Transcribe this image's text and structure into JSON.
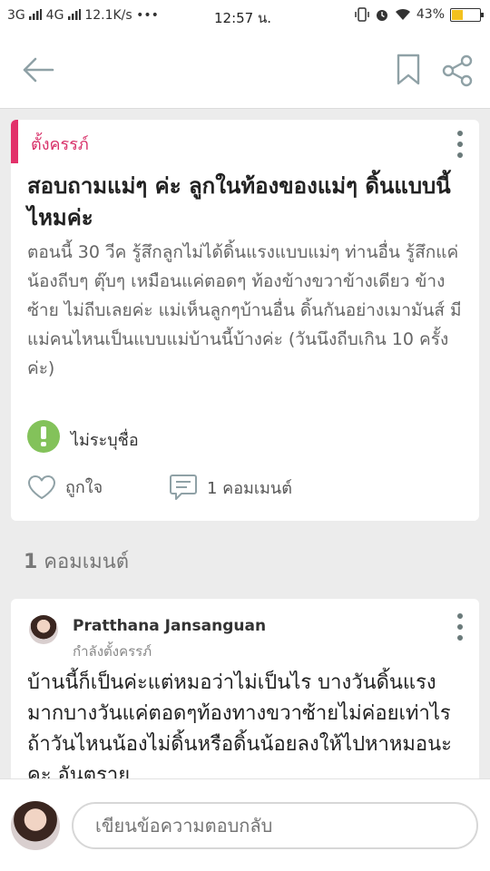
{
  "status_bar": {
    "left": "3G ",
    "left_2": " 4G ",
    "speed": " 12.1K/s •••",
    "time": "12:57 น.",
    "battery_text": "43%",
    "battery_level": 0.43,
    "battery_color": "#f3c11e"
  },
  "post": {
    "tag": "ตั้งครรภ์",
    "title": "สอบถามแม่ๆ ค่ะ ลูกในท้องของแม่ๆ ดิ้นแบบนี้ไหมค่ะ",
    "body": "ตอนนี้ 30 วีค รู้สึกลูกไม่ได้ดิ้นแรงแบบแม่ๆ ท่านอื่น รู้สึกแค่น้องถีบๆ ตุ๊บๆ เหมือนแค่ตอดๆ ท้องข้างขวาข้างเดียว ข้างซ้าย ไม่ถีบเลยค่ะ แม่เห็นลูกๆบ้านอื่น ดิ้นกันอย่างเมามันส์ มีแม่คนไหนเป็นแบบแม่บ้านนี้บ้างค่ะ (วันนึงถีบเกิน 10 ครั้งค่ะ)",
    "author": "ไม่ระบุชื่อ",
    "like_label": "ถูกใจ",
    "comment_label": "1 คอมเมนต์"
  },
  "comments_header": {
    "count": "1",
    "label": " คอมเมนต์"
  },
  "comments": [
    {
      "author": "Pratthana Jansanguan",
      "subtitle": "กำลังตั้งครรภ์",
      "text": "บ้านนี้ก็เป็นค่ะแต่หมอว่าไม่เป็นไร บางวันดิ้นแรงมากบางวันแค่ตอดๆท้องทางขวาซ้ายไม่ค่อยเท่าไร ถ้าวันไหนน้องไม่ดิ้นหรือดิ้นน้อยลงให้ไปหาหมอนะคะ อันตราย"
    }
  ],
  "composer": {
    "placeholder": "เขียนข้อความตอบกลับ"
  },
  "icons": {
    "back": "arrow-left-icon",
    "bookmark": "bookmark-icon",
    "share": "share-icon",
    "more": "more-vertical-icon",
    "like": "heart-icon",
    "comment": "comment-icon",
    "anonymous": "anonymous-avatar-icon"
  },
  "colors": {
    "accent": "#e2316a",
    "anonymous_avatar": "#83c25a",
    "icon_gray": "#6a7a7a"
  }
}
